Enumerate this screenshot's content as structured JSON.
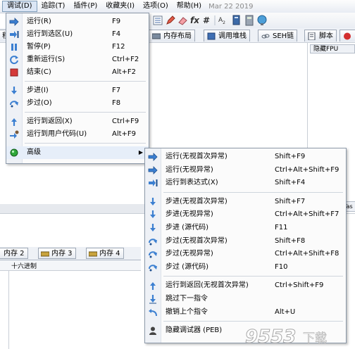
{
  "menubar": {
    "items": [
      "调试(D)",
      "追踪(T)",
      "插件(P)",
      "收藏夹(I)",
      "选项(O)",
      "帮助(H)"
    ],
    "date": "Mar 22 2019"
  },
  "tabs": [
    "程",
    "内存布局",
    "调用堆栈",
    "SEH链",
    "脚本"
  ],
  "fpu_label": "隐藏FPU",
  "right_fragment": "Tas",
  "memory_tabs": [
    "内存 2",
    "内存 3",
    "内存 4"
  ],
  "hex_header": "十六进制",
  "debug_menu": {
    "items": [
      {
        "label": "运行(R)",
        "key": "F9",
        "icon": "arrow-right-icon"
      },
      {
        "label": "运行到选区(U)",
        "key": "F4",
        "icon": "run-to-selection-icon"
      },
      {
        "label": "暂停(P)",
        "key": "F12",
        "icon": "pause-icon"
      },
      {
        "label": "重新运行(S)",
        "key": "Ctrl+F2",
        "icon": "restart-icon"
      },
      {
        "label": "结束(C)",
        "key": "Alt+F2",
        "icon": "stop-icon"
      },
      {
        "label": "步进(I)",
        "key": "F7",
        "icon": "step-into-icon"
      },
      {
        "label": "步过(O)",
        "key": "F8",
        "icon": "step-over-icon"
      },
      {
        "label": "运行到返回(X)",
        "key": "Ctrl+F9",
        "icon": "run-to-return-icon"
      },
      {
        "label": "运行到用户代码(U)",
        "key": "Alt+F9",
        "icon": "run-to-user-code-icon"
      },
      {
        "label": "高级",
        "key": "",
        "icon": "green-ball-icon"
      }
    ]
  },
  "advanced_menu": {
    "items": [
      {
        "label": "运行(无视首次异常)",
        "key": "Shift+F9",
        "icon": "arrow-right-icon"
      },
      {
        "label": "运行(无视异常)",
        "key": "Ctrl+Alt+Shift+F9",
        "icon": "arrow-right-icon"
      },
      {
        "label": "运行到表达式(X)",
        "key": "Shift+F4",
        "icon": "run-to-expression-icon"
      },
      {
        "label": "步进(无视首次异常)",
        "key": "Shift+F7",
        "icon": "step-into-icon"
      },
      {
        "label": "步进(无视异常)",
        "key": "Ctrl+Alt+Shift+F7",
        "icon": "step-into-icon"
      },
      {
        "label": "步进 (源代码)",
        "key": "F11",
        "icon": "step-into-icon"
      },
      {
        "label": "步过(无视首次异常)",
        "key": "Shift+F8",
        "icon": "step-over-icon"
      },
      {
        "label": "步过(无视异常)",
        "key": "Ctrl+Alt+Shift+F8",
        "icon": "step-over-icon"
      },
      {
        "label": "步过 (源代码)",
        "key": "F10",
        "icon": "step-over-icon"
      },
      {
        "label": "运行到返回(无视首次异常)",
        "key": "Ctrl+Shift+F9",
        "icon": "run-to-return-icon"
      },
      {
        "label": "跳过下一指令",
        "key": "",
        "icon": "skip-down-icon"
      },
      {
        "label": "撤销上个指令",
        "key": "Alt+U",
        "icon": "undo-icon"
      },
      {
        "label": "隐藏调试器 (PEB)",
        "key": "",
        "icon": "hide-debugger-icon"
      }
    ]
  },
  "watermark": {
    "text": "9553",
    "suffix": "下载"
  }
}
